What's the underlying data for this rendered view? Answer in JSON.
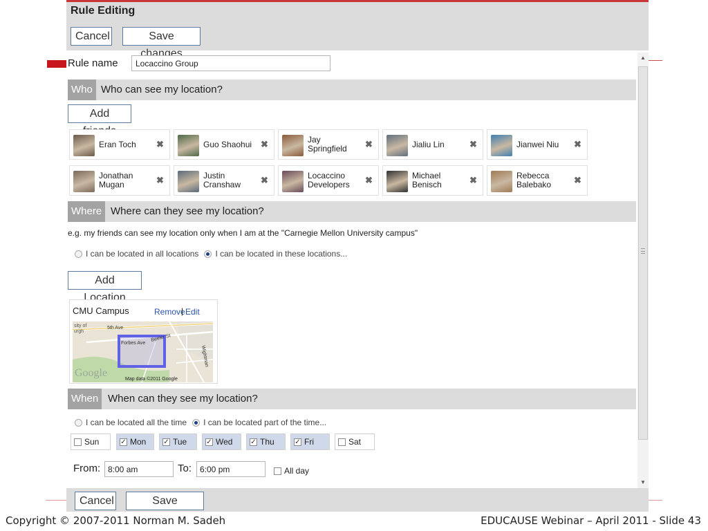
{
  "header": {
    "title": "Rule Editing",
    "cancel_label": "Cancel",
    "save_label": "Save changes"
  },
  "rule": {
    "name_label": "Rule name",
    "name_value": "Locaccino Group"
  },
  "who": {
    "tag": "Who",
    "title": "Who can see my location?",
    "add_label": "Add friends",
    "friends": [
      {
        "name": "Eran Toch"
      },
      {
        "name": "Guo Shaohui"
      },
      {
        "name": "Jay Springfield"
      },
      {
        "name": "Jialiu Lin"
      },
      {
        "name": "Jianwei Niu"
      },
      {
        "name": "Jonathan Mugan"
      },
      {
        "name": "Justin Cranshaw"
      },
      {
        "name": "Locaccino Developers"
      },
      {
        "name": "Michael Benisch"
      },
      {
        "name": "Rebecca Balebako"
      }
    ],
    "remove_glyph": "✖"
  },
  "where": {
    "tag": "Where",
    "title": "Where can they see my location?",
    "hint": "e.g. my friends can see my location only when I am at the \"Carnegie Mellon University campus\"",
    "option_all": "I can be located in all locations",
    "option_these": "I can be located in these locations...",
    "selected": "these",
    "add_label": "Add Location",
    "location": {
      "name": "CMU Campus",
      "remove_label": "Remove",
      "separator": "|",
      "edit_label": "Edit",
      "map": {
        "street_5th": "5th Ave",
        "street_forbes": "Forbes Ave",
        "street_beeler": "Beeler St",
        "street_wightman": "Wightman",
        "city_fragment_1": "sity of",
        "city_fragment_2": "urgh",
        "logo": "Google",
        "attribution": "Map data ©2011 Google"
      }
    }
  },
  "when": {
    "tag": "When",
    "title": "When can they see my location?",
    "option_all": "I can be located all the time",
    "option_part": "I can be located part of the time...",
    "selected": "part",
    "days": [
      {
        "label": "Sun",
        "checked": false
      },
      {
        "label": "Mon",
        "checked": true
      },
      {
        "label": "Tue",
        "checked": true
      },
      {
        "label": "Wed",
        "checked": true
      },
      {
        "label": "Thu",
        "checked": true
      },
      {
        "label": "Fri",
        "checked": true
      },
      {
        "label": "Sat",
        "checked": false
      }
    ],
    "from_label": "From:",
    "from_value": "8:00 am",
    "to_label": "To:",
    "to_value": "6:00 pm",
    "all_day_label": "All day",
    "all_day_checked": false
  },
  "footer": {
    "cancel_label": "Cancel",
    "save_label": "Save changes"
  },
  "slide": {
    "copyright": "Copyright © 2007-2011 Norman M. Sadeh",
    "label": "EDUCAUSE Webinar – April 2011 - Slide 43"
  },
  "colors": {
    "accent_red": "#c8161d",
    "section_tag_gray": "#a3a3a3",
    "panel_gray": "#dcdcdc",
    "day_selected": "#cfd9ea",
    "link_blue": "#2a56a8"
  }
}
